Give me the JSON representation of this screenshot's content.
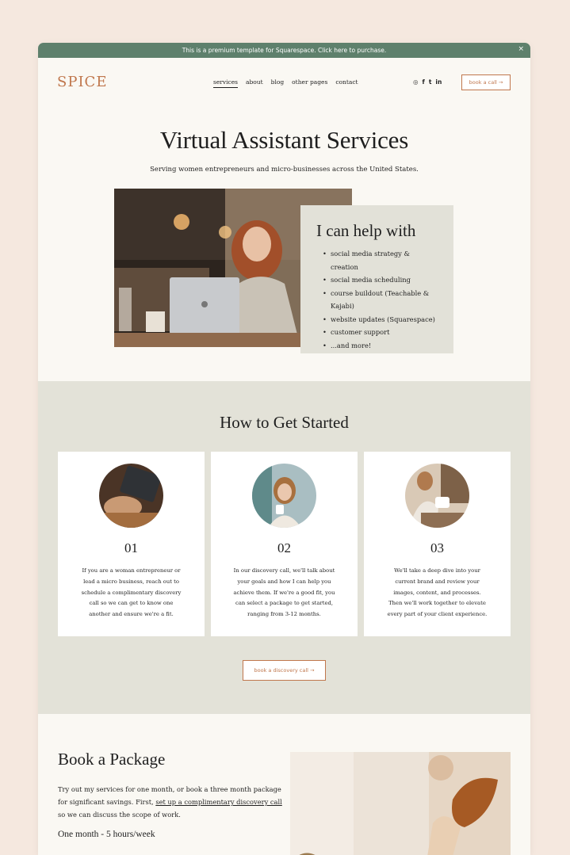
{
  "banner": {
    "text": "This is a premium template for Squarespace. Click here to purchase.",
    "close": "×"
  },
  "nav": {
    "logo": "SPICE",
    "items": [
      "services",
      "about",
      "blog",
      "other pages",
      "contact"
    ],
    "social": [
      "instagram-icon",
      "facebook-icon",
      "twitter-icon",
      "linkedin-icon"
    ],
    "social_glyphs": [
      "◎",
      "f",
      "t",
      "in"
    ],
    "button": "book a call →"
  },
  "hero": {
    "title": "Virtual Assistant Services",
    "subtitle": "Serving women entrepreneurs and micro-businesses across the United States."
  },
  "help": {
    "title": "I can help with",
    "items": [
      "social media strategy & creation",
      "social media scheduling",
      "course buildout (Teachable & Kajabi)",
      "website updates (Squarespace)",
      "customer support",
      "...and more!"
    ]
  },
  "started": {
    "title": "How to Get Started",
    "steps": [
      {
        "num": "01",
        "text": "If you are a woman entrepreneur or lead a micro business, reach out to schedule a complimentary discovery call so we can get to know one another and ensure we're a fit."
      },
      {
        "num": "02",
        "text": "In our discovery call, we'll talk about your goals and how I can help you achieve them. If we're a good fit, you can select a package to get started, ranging from 3-12 months."
      },
      {
        "num": "03",
        "text": "We'll take a deep dive into your current brand and review your images, content, and processes. Then we'll work together to elevate every part of your client experience."
      }
    ],
    "button": "book a discovery call →"
  },
  "package": {
    "title": "Book a Package",
    "intro_before": "Try out my services for one month, or book a three month package for significant savings. First, ",
    "intro_link": "set up a complimentary discovery call",
    "intro_after": " so we can discuss the scope of work.",
    "subheading": "One month - 5 hours/week"
  },
  "colors": {
    "accent": "#c0774d",
    "banner": "#5e806c",
    "panel": "#e3e2d8",
    "page": "#faf8f3",
    "background": "#f5e8df"
  }
}
